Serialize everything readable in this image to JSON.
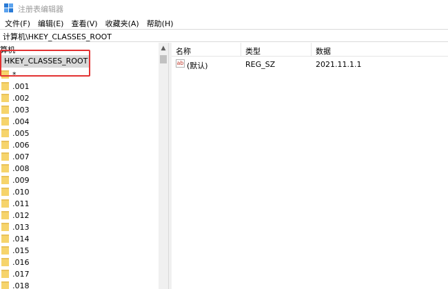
{
  "window": {
    "title": "注册表编辑器"
  },
  "menu": [
    "文件(F)",
    "编辑(E)",
    "查看(V)",
    "收藏夹(A)",
    "帮助(H)"
  ],
  "address": "计算机\\HKEY_CLASSES_ROOT",
  "tree": {
    "root_label": "算机",
    "selected": "HKEY_CLASSES_ROOT",
    "items": [
      "*",
      ".001",
      ".002",
      ".003",
      ".004",
      ".005",
      ".006",
      ".007",
      ".008",
      ".009",
      ".010",
      ".011",
      ".012",
      ".013",
      ".014",
      ".015",
      ".016",
      ".017",
      ".018"
    ]
  },
  "list": {
    "columns": [
      "名称",
      "类型",
      "数据"
    ],
    "rows": [
      {
        "icon": "string-value-icon",
        "icon_text": "ab",
        "name": "(默认)",
        "type": "REG_SZ",
        "data": "2021.11.1.1"
      }
    ]
  },
  "colors": {
    "highlight_box": "#e23131",
    "selection": "#d9d9d9",
    "folder": "#f6d46c"
  }
}
